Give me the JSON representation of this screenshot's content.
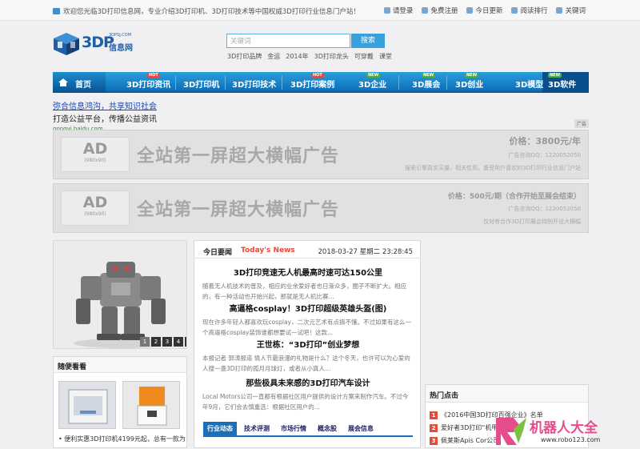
{
  "topbar": {
    "welcome": "欢迎您光临3D打印信息网，专业介绍3D打印机、3D打印技术等中国权威3D打印行业信息门户站！",
    "links": [
      "请登录",
      "免费注册",
      "今日更新",
      "阅读排行",
      "关键词"
    ]
  },
  "logo": {
    "brand": "3DP",
    "name": "信息网",
    "domain": "3DPSJ.COM"
  },
  "search": {
    "placeholder": "关键词",
    "button": "搜索",
    "hotwords": [
      "3D打印品牌",
      "金运",
      "2014年",
      "3D打印龙头",
      "可穿戴",
      "课堂"
    ]
  },
  "nav": {
    "home": "首页",
    "items": [
      "3D打印资讯",
      "3D打印机",
      "3D打印技术",
      "3D打印案例",
      "3D企业",
      "3D展会",
      "3D创业",
      "3D模型",
      "3D软件"
    ],
    "badges": [
      "HOT",
      "HOT",
      "NEW",
      "NEW",
      "NEW",
      "NEW"
    ]
  },
  "textad": {
    "line1": "弥合信息鸿沟，共享知识社会",
    "line2": "打造公益平台，传播公益资讯",
    "url": "qongyi.baidu.com",
    "tag": "广告"
  },
  "banners": [
    {
      "ad": "AD",
      "size": "(980x90)",
      "headline": "全站第一屏超大横幅广告",
      "price": "价格：3800元/年",
      "tel": "广告咨询QQ：1220052050",
      "desc": "搜索引擎真实买量，相关性高，备受用户喜欢的3D打印行业信息门户站"
    },
    {
      "ad": "AD",
      "size": "(980x90)",
      "headline": "全站第一屏超大横幅广告",
      "price": "价格：500元/期（合作开始至展会结束）",
      "tel": "广告咨询QQ：1220052050",
      "desc": "仅对有合作3D打印展会特别开设大横幅"
    }
  ],
  "slider": {
    "dots": [
      "1",
      "2",
      "3",
      "4",
      "5"
    ]
  },
  "watch": {
    "title": "随便看看",
    "caption": "• 便利实惠3D打印机4199元起，总有一款为"
  },
  "news": {
    "label": "今日要闻",
    "label_en": "Today's News",
    "datetime": "2018-03-27 星期二 23:28:45",
    "articles": [
      {
        "title": "3D打印竞速无人机最高时速可达150公里",
        "summary": "随着无人机技术的普及，相应的业余爱好者也日渐众多，圈子不断扩大。相应的，有一种活动也开始兴起，那就是无人机比赛..."
      },
      {
        "title": "高逼格cosplay！3D打印超级英雄头盔(图)",
        "summary": "现在许多年轻人都喜欢玩cosplay，二次元艺术有点搞不懂。不过如果有这么一个高逼格cosplay装饰谁都想要试一试吧！这款..."
      },
      {
        "title": "王世栋：“3D打印”创业梦想",
        "summary": "本报记者 郭涛报道 情人节最浪漫的礼物是什么？这个冬天，也许可以为心爱的人搜一盏3D打印的孤月月球灯，或者从小真人..."
      },
      {
        "title": "那些极具未来感的3D打印汽车设计",
        "summary": "Local Motors公司一直都有根据社区用户提供的设计方案来制作汽车。不过今年9月，它们会去慎重选：根据社区用户的..."
      }
    ],
    "tabs": [
      "行业动态",
      "技术评测",
      "市场行情",
      "概念股",
      "展会信息"
    ]
  },
  "hot": {
    "title": "热门点击",
    "items": [
      {
        "rank": "1",
        "text": "《2016中国3D打印百强企业》名单"
      },
      {
        "rank": "2",
        "text": "爱好者3D打印“机甲"
      },
      {
        "rank": "3",
        "text": "佩莱斯Apis Cor公司"
      }
    ]
  },
  "watermark": {
    "name": "机器人大全",
    "url": "www.robo123.com"
  },
  "colors": {
    "nav": "#1a7cc6",
    "accent": "#e8493a",
    "link": "#1a46a8"
  }
}
